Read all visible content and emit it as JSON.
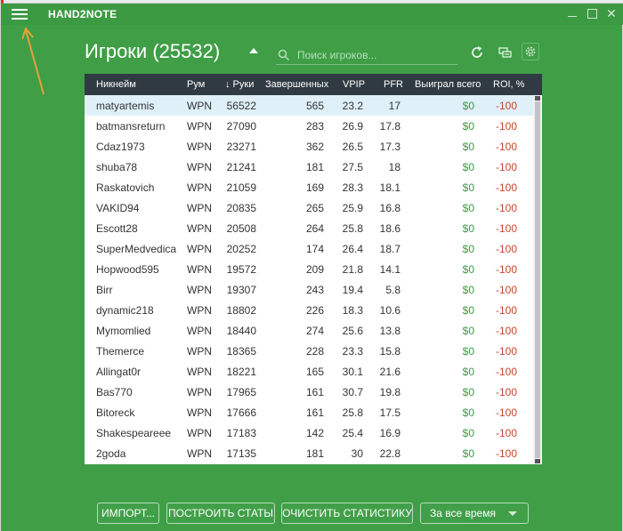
{
  "app": {
    "title": "HAND2NOTE",
    "close_glyph": "✕"
  },
  "header": {
    "title": "Игроки (25532)",
    "search_placeholder": "Поиск игроков..."
  },
  "icons": {
    "menu": "hamburger-menu-icon",
    "search": "search-icon",
    "refresh": "refresh-icon",
    "filter": "filter-icon",
    "settings": "gear-icon",
    "accent_arrow_color": "#e8a03a",
    "header_bg": "#2f3a43",
    "app_bg": "#3f9e46",
    "won_color": "#3c9b43",
    "roi_color": "#c8452d"
  },
  "table": {
    "columns": [
      "Никнейм",
      "Рум",
      "↓ Руки",
      "Завершенных",
      "VPIP",
      "PFR",
      "Выиграл всего",
      "ROI, %"
    ],
    "rows": [
      [
        "matyartemis",
        "WPN",
        "56522",
        "565",
        "23.2",
        "17",
        "$0",
        "-100"
      ],
      [
        "batmansreturn",
        "WPN",
        "27090",
        "283",
        "26.9",
        "17.8",
        "$0",
        "-100"
      ],
      [
        "Cdaz1973",
        "WPN",
        "23271",
        "362",
        "26.5",
        "17.3",
        "$0",
        "-100"
      ],
      [
        "shuba78",
        "WPN",
        "21241",
        "181",
        "27.5",
        "18",
        "$0",
        "-100"
      ],
      [
        "Raskatovich",
        "WPN",
        "21059",
        "169",
        "28.3",
        "18.1",
        "$0",
        "-100"
      ],
      [
        "VAKID94",
        "WPN",
        "20835",
        "265",
        "25.9",
        "16.8",
        "$0",
        "-100"
      ],
      [
        "Escott28",
        "WPN",
        "20508",
        "264",
        "25.8",
        "18.6",
        "$0",
        "-100"
      ],
      [
        "SuperMedvedica",
        "WPN",
        "20252",
        "174",
        "26.4",
        "18.7",
        "$0",
        "-100"
      ],
      [
        "Hopwood595",
        "WPN",
        "19572",
        "209",
        "21.8",
        "14.1",
        "$0",
        "-100"
      ],
      [
        "Birr",
        "WPN",
        "19307",
        "243",
        "19.4",
        "5.8",
        "$0",
        "-100"
      ],
      [
        "dynamic218",
        "WPN",
        "18802",
        "226",
        "18.3",
        "10.6",
        "$0",
        "-100"
      ],
      [
        "Mymomlied",
        "WPN",
        "18440",
        "274",
        "25.6",
        "13.8",
        "$0",
        "-100"
      ],
      [
        "Themerce",
        "WPN",
        "18365",
        "228",
        "23.3",
        "15.8",
        "$0",
        "-100"
      ],
      [
        "Allingat0r",
        "WPN",
        "18221",
        "165",
        "30.1",
        "21.6",
        "$0",
        "-100"
      ],
      [
        "Bas770",
        "WPN",
        "17965",
        "161",
        "30.7",
        "19.8",
        "$0",
        "-100"
      ],
      [
        "Bitoreck",
        "WPN",
        "17666",
        "161",
        "25.8",
        "17.5",
        "$0",
        "-100"
      ],
      [
        "Shakespeareee",
        "WPN",
        "17183",
        "142",
        "25.4",
        "16.9",
        "$0",
        "-100"
      ],
      [
        "2goda",
        "WPN",
        "17135",
        "181",
        "30",
        "22.8",
        "$0",
        "-100"
      ]
    ]
  },
  "footer": {
    "import_label": "ИМПОРТ...",
    "build_label": "ПОСТРОИТЬ СТАТЫ",
    "clear_label": "ОЧИСТИТЬ СТАТИСТИКУ",
    "period_label": "За все время"
  }
}
